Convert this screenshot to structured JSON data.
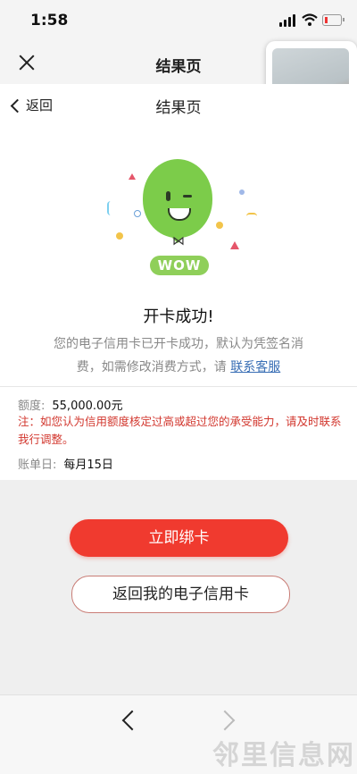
{
  "status_bar": {
    "time": "1:58"
  },
  "app_bar": {
    "title": "结果页"
  },
  "nav_bar": {
    "back_label": "返回",
    "title": "结果页"
  },
  "hero": {
    "badge_text": "WOW",
    "success_title": "开卡成功!",
    "description": "您的电子信用卡已开卡成功，默认为凭签名消费，如需修改消费方式，请",
    "service_link": "联系客服"
  },
  "details": {
    "limit_label": "额度:",
    "limit_value": "55,000.00元",
    "notice": "注：如您认为信用额度核定过高或超过您的承受能力，请及时联系我行调整。",
    "billing_label": "账单日:",
    "billing_value": "每月15日"
  },
  "actions": {
    "bind_card": "立即绑卡",
    "back_to_card": "返回我的电子信用卡"
  },
  "watermark": "邻里信息网",
  "colors": {
    "primary": "#f03a2f",
    "link": "#3a6fb5",
    "notice": "#d2372e",
    "balloon": "#7ccc4a"
  }
}
